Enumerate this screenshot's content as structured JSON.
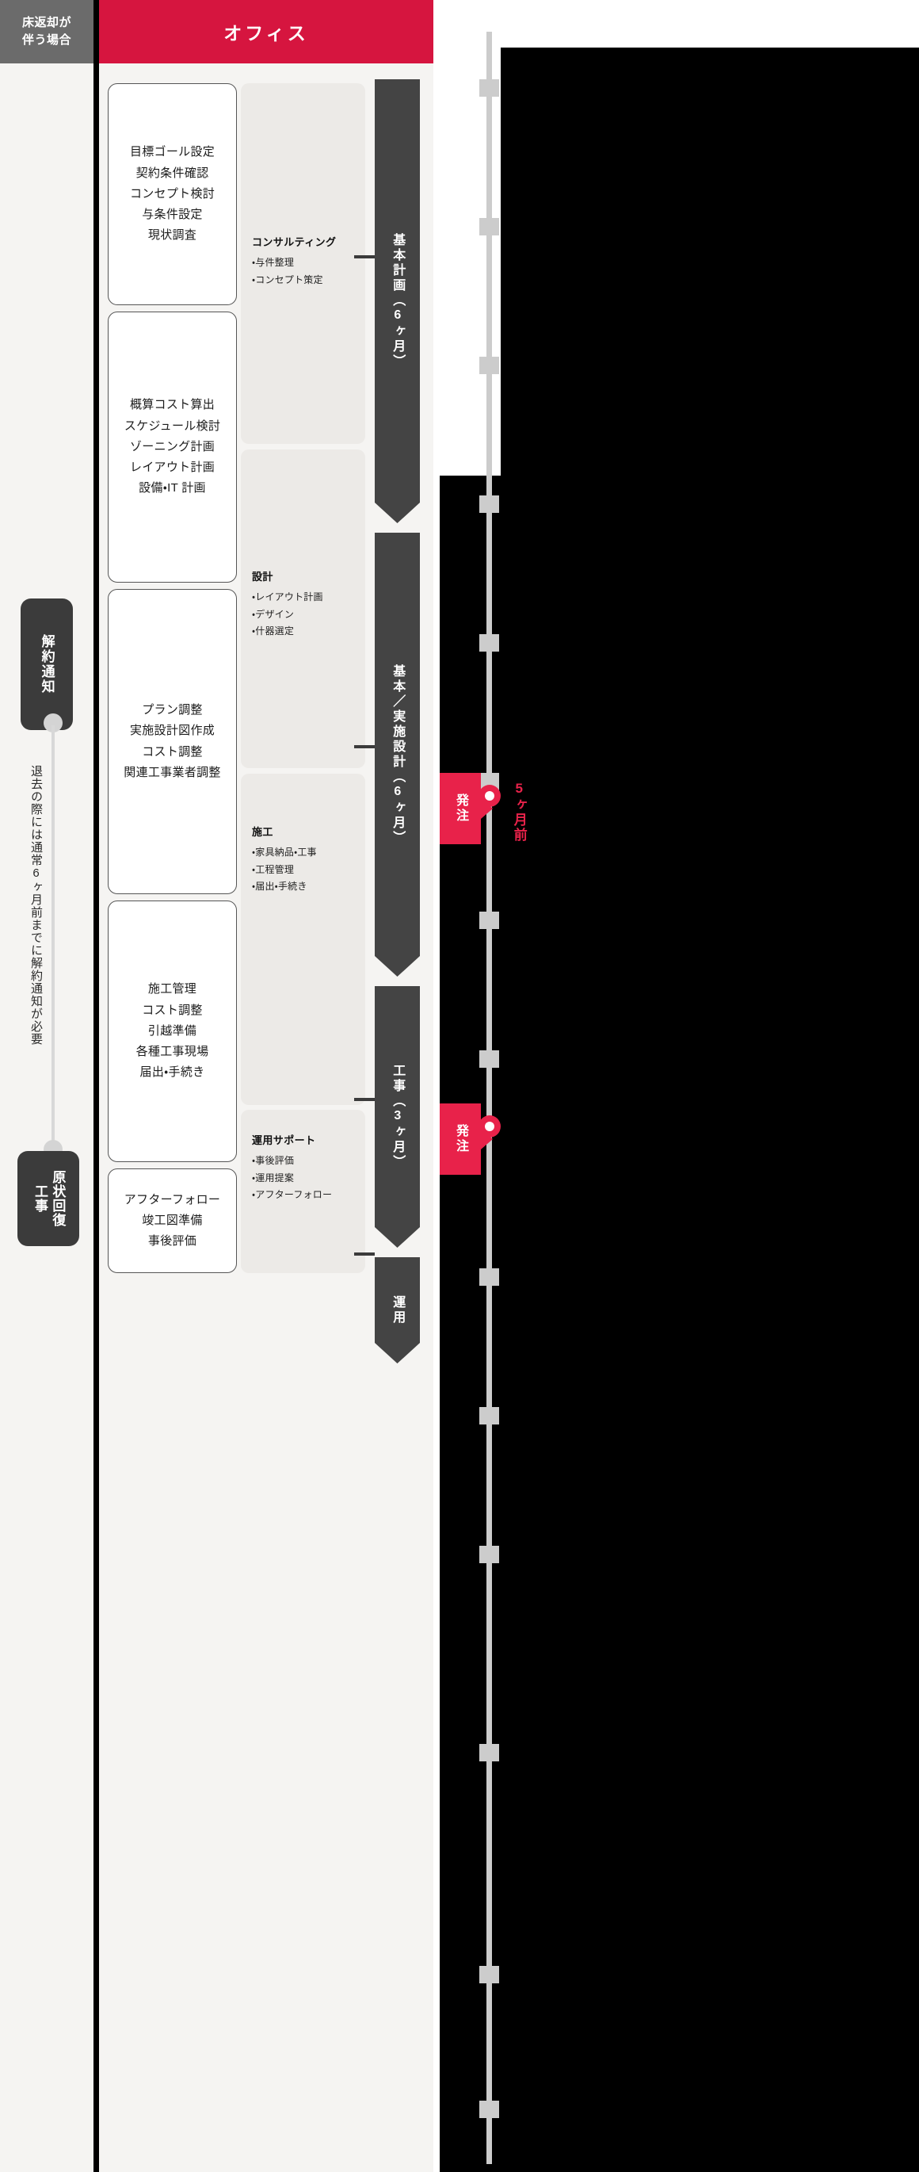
{
  "left_column": {
    "header_lines": [
      "床返却が",
      "伴う場合"
    ],
    "cancel_pill": "解約通知",
    "note_vertical": "退去の際には通常6ヶ月前までに解約通知が必要",
    "restore_pill": {
      "main": "原状回復",
      "sub": "工事"
    }
  },
  "banner": {
    "title": "オフィス"
  },
  "task_cards": [
    {
      "id": "card-1",
      "lines": [
        "目標ゴール設定",
        "契約条件確認",
        "コンセプト検討",
        "与条件設定",
        "現状調査"
      ]
    },
    {
      "id": "card-2",
      "lines": [
        "概算コスト算出",
        "スケジュール検討",
        "ゾーニング計画",
        "レイアウト計画",
        "設備・IT 計画"
      ]
    },
    {
      "id": "card-3",
      "lines": [
        "プラン調整",
        "実施設計図作成",
        "コスト調整",
        "関連工事業者調整"
      ]
    },
    {
      "id": "card-4",
      "lines": [
        "施工管理",
        "コスト調整",
        "引越準備",
        "各種工事現場",
        "届出・手続き"
      ]
    },
    {
      "id": "card-5",
      "lines": [
        "アフターフォロー",
        "竣工図準備",
        "事後評価"
      ]
    }
  ],
  "detail_blocks": [
    {
      "id": "detail-consulting",
      "title": "コンサルティング",
      "items": [
        "与件整理",
        "コンセプト策定"
      ]
    },
    {
      "id": "detail-design",
      "title": "設計",
      "items": [
        "レイアウト計画",
        "デザイン",
        "什器選定"
      ]
    },
    {
      "id": "detail-construction",
      "title": "施工",
      "items": [
        "家具納品・工事",
        "工程管理",
        "届出・手続き"
      ]
    },
    {
      "id": "detail-support",
      "title": "運用サポート",
      "items": [
        "事後評価",
        "運用提案",
        "アフターフォロー"
      ]
    }
  ],
  "phases": [
    {
      "id": "phase-basic-plan",
      "label": "基本計画（6ヶ月）"
    },
    {
      "id": "phase-design",
      "label": "基本／実施設計（6ヶ月）"
    },
    {
      "id": "phase-construction",
      "label": "工事（3ヶ月）"
    },
    {
      "id": "phase-operation",
      "label": "運用"
    }
  ],
  "right_strip": {
    "order_badges": [
      {
        "id": "order-badge-1",
        "label": "発注"
      },
      {
        "id": "order-badge-2",
        "label": "発注"
      }
    ],
    "side_labels": [
      {
        "id": "side-label-1",
        "text": "5ヶ月前"
      }
    ]
  },
  "colors": {
    "brand_red": "#d6153f",
    "order_red": "#e8224a",
    "dark": "#3b3b3b",
    "phase_dark": "#444444",
    "panel_bg": "#f5f4f2",
    "detail_bg": "#eceae7",
    "header_gray": "#6b6b6b"
  }
}
